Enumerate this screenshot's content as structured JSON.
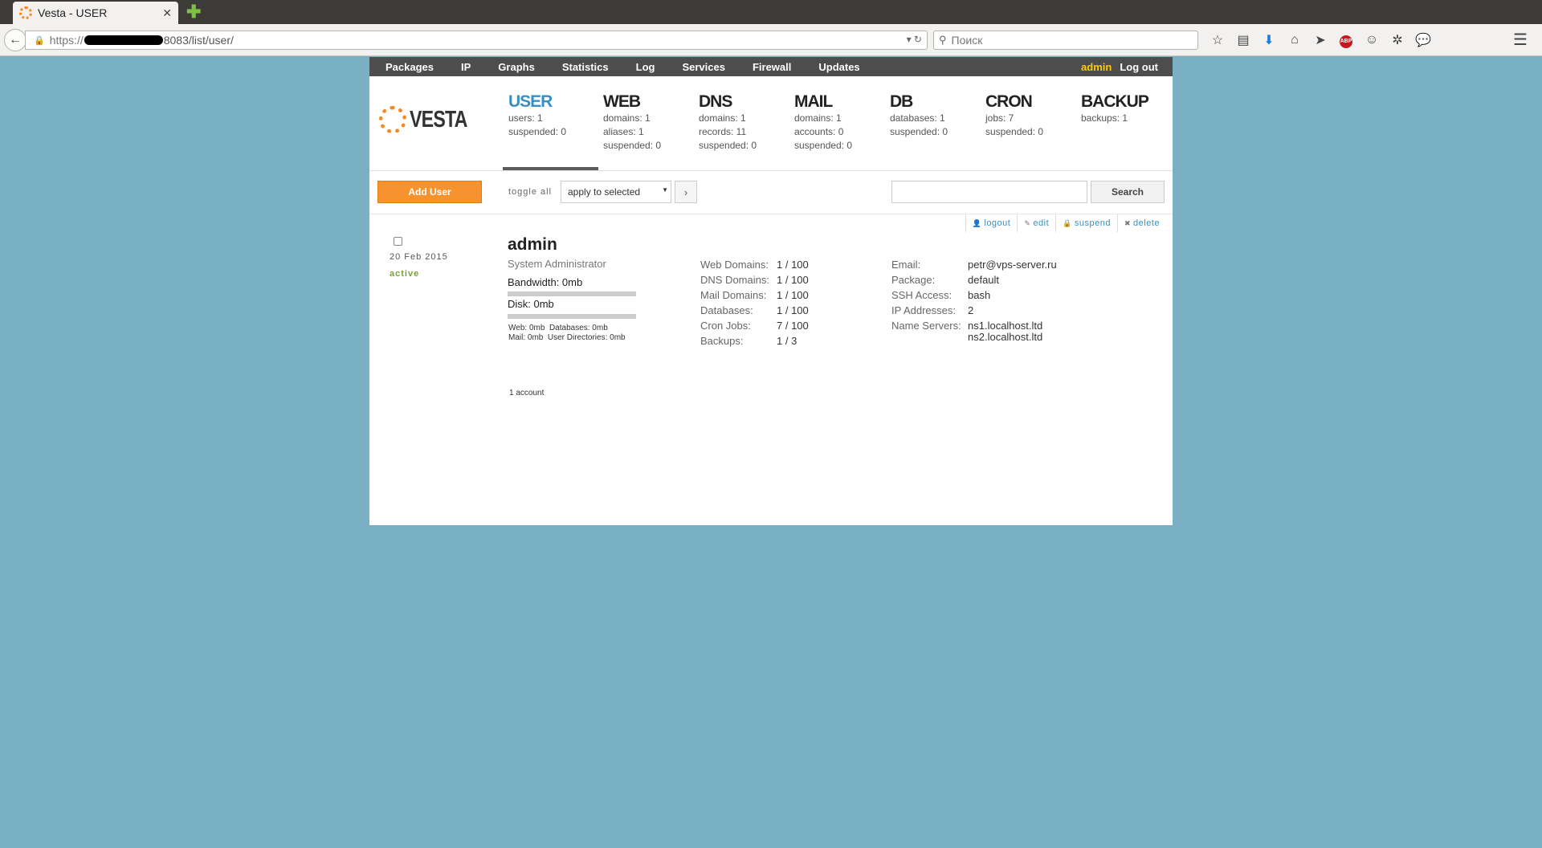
{
  "browser": {
    "tab_title": "Vesta - USER",
    "url_prefix": "https://",
    "url_suffix": "8083/list/user/",
    "search_placeholder": "Поиск"
  },
  "topmenu": {
    "items": [
      "Packages",
      "IP",
      "Graphs",
      "Statistics",
      "Log",
      "Services",
      "Firewall",
      "Updates"
    ],
    "user": "admin",
    "logout": "Log out"
  },
  "logo": {
    "text": "VESTA"
  },
  "sections": [
    {
      "title": "USER",
      "stats": [
        "users: 1",
        "suspended: 0"
      ]
    },
    {
      "title": "WEB",
      "stats": [
        "domains: 1",
        "aliases: 1",
        "suspended: 0"
      ]
    },
    {
      "title": "DNS",
      "stats": [
        "domains: 1",
        "records: 11",
        "suspended: 0"
      ]
    },
    {
      "title": "MAIL",
      "stats": [
        "domains: 1",
        "accounts: 0",
        "suspended: 0"
      ]
    },
    {
      "title": "DB",
      "stats": [
        "databases: 1",
        "suspended: 0"
      ]
    },
    {
      "title": "CRON",
      "stats": [
        "jobs: 7",
        "suspended: 0"
      ]
    },
    {
      "title": "BACKUP",
      "stats": [
        "backups: 1"
      ]
    }
  ],
  "toolbar": {
    "add_user": "Add User",
    "toggle_all": "toggle all",
    "apply_selected": "apply to selected",
    "apply_go": "›",
    "search": "Search"
  },
  "user_row": {
    "actions": [
      "logout",
      "edit",
      "suspend",
      "delete"
    ],
    "date": "20 Feb 2015",
    "status": "active",
    "name": "admin",
    "role": "System Administrator",
    "bandwidth": "Bandwidth: 0mb",
    "bandwidth_fraction": 0,
    "disk": "Disk: 0mb",
    "disk_fraction": 0,
    "disk_detail_1": "Web: 0mb  Databases: 0mb",
    "disk_detail_2": "Mail: 0mb  User Directories: 0mb",
    "limits": [
      {
        "k": "Web Domains:",
        "v": "1 / 100"
      },
      {
        "k": "DNS Domains:",
        "v": "1 / 100"
      },
      {
        "k": "Mail Domains:",
        "v": "1 / 100"
      },
      {
        "k": "Databases:",
        "v": "1 / 100"
      },
      {
        "k": "Cron Jobs:",
        "v": "7 / 100"
      },
      {
        "k": "Backups:",
        "v": "1 / 3"
      }
    ],
    "info": [
      {
        "k": "Email:",
        "v": "petr@vps-server.ru"
      },
      {
        "k": "Package:",
        "v": "default"
      },
      {
        "k": "SSH Access:",
        "v": "bash"
      },
      {
        "k": "IP Addresses:",
        "v": "2"
      },
      {
        "k": "Name Servers:",
        "v": "ns1.localhost.ltd"
      },
      {
        "k": "",
        "v": "ns2.localhost.ltd"
      }
    ]
  },
  "footer": {
    "count": "1 account"
  }
}
